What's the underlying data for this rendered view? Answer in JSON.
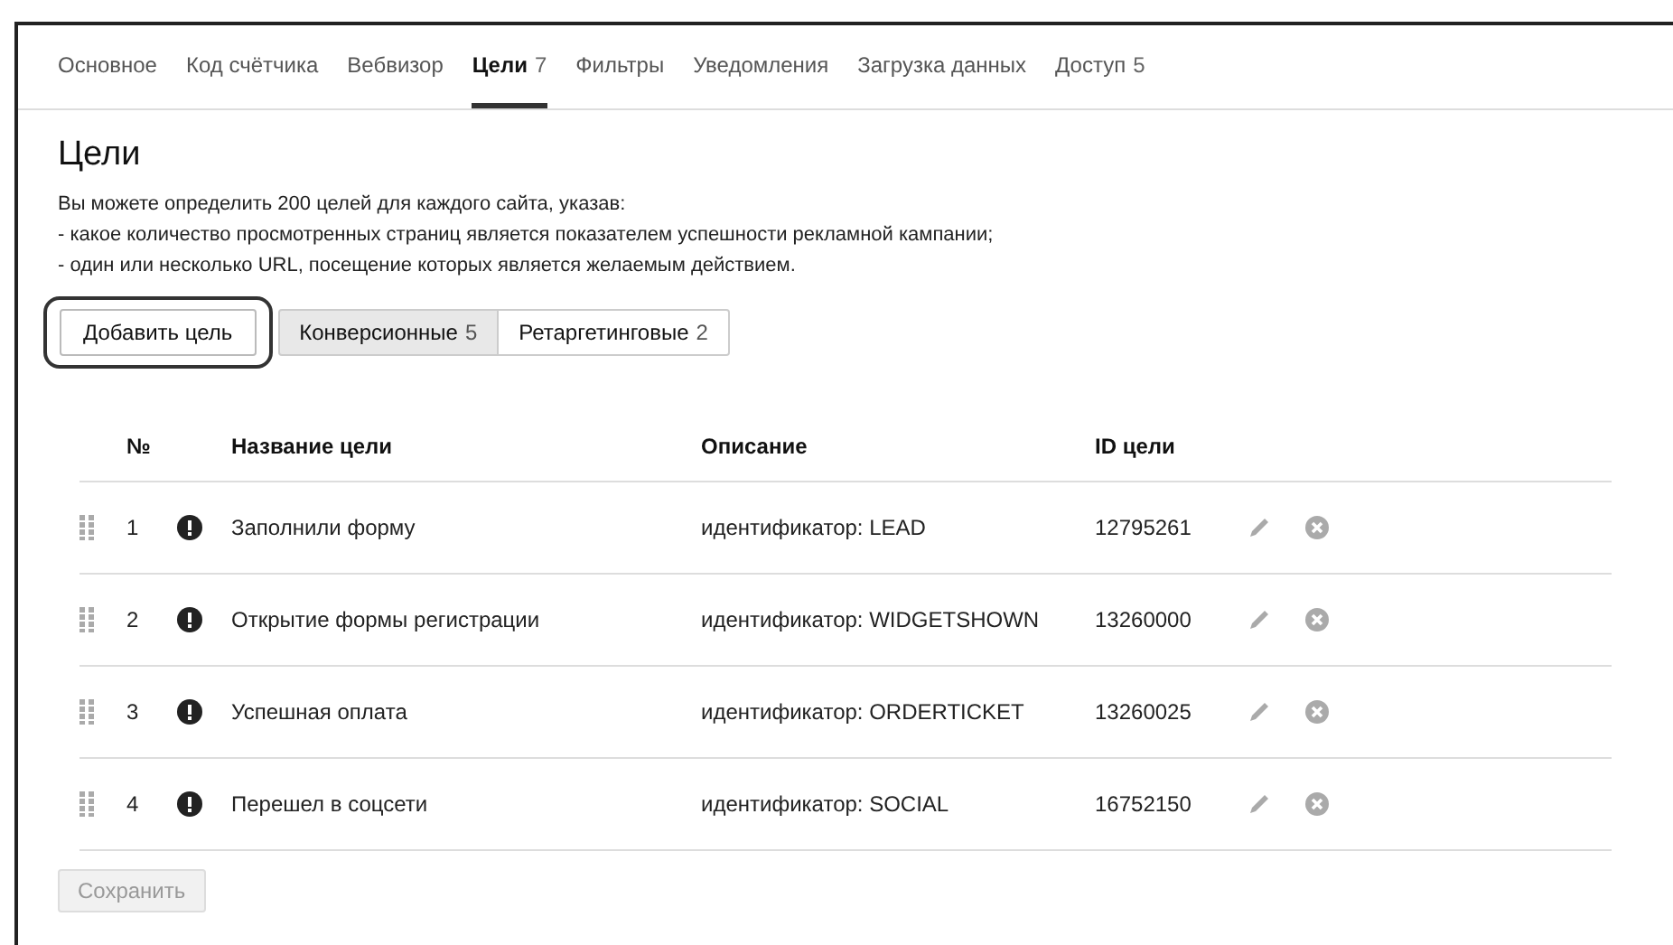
{
  "tabs": [
    {
      "label": "Основное",
      "selected": false
    },
    {
      "label": "Код счётчика",
      "selected": false
    },
    {
      "label": "Вебвизор",
      "selected": false
    },
    {
      "label": "Цели",
      "count": "7",
      "selected": true
    },
    {
      "label": "Фильтры",
      "selected": false
    },
    {
      "label": "Уведомления",
      "selected": false
    },
    {
      "label": "Загрузка данных",
      "selected": false
    },
    {
      "label": "Доступ",
      "count": "5",
      "selected": false
    }
  ],
  "title": "Цели",
  "intro": [
    "Вы можете определить 200 целей для каждого сайта, указав:",
    "- какое количество просмотренных страниц является показателем успешности рекламной кампании;",
    "- один или несколько URL, посещение которых является желаемым действием."
  ],
  "add_button": {
    "label": "Добавить цель",
    "highlighted": true
  },
  "filters": [
    {
      "label": "Конверсионные",
      "count": "5",
      "selected": true
    },
    {
      "label": "Ретаргетинговые",
      "count": "2",
      "selected": false
    }
  ],
  "table": {
    "columns": [
      "№",
      "Название цели",
      "Описание",
      "ID цели"
    ],
    "rows": [
      {
        "number": "1",
        "name": "Заполнили форму",
        "description": "идентификатор: LEAD",
        "id": "12795261"
      },
      {
        "number": "2",
        "name": "Открытие формы регистрации",
        "description": "идентификатор: WIDGETSHOWN",
        "id": "13260000"
      },
      {
        "number": "3",
        "name": "Успешная оплата",
        "description": "идентификатор: ORDERTICKET",
        "id": "13260025"
      },
      {
        "number": "4",
        "name": "Перешел в соцсети",
        "description": "идентификатор: SOCIAL",
        "id": "16752150"
      }
    ]
  },
  "save_button": {
    "label": "Сохранить",
    "disabled": true
  }
}
